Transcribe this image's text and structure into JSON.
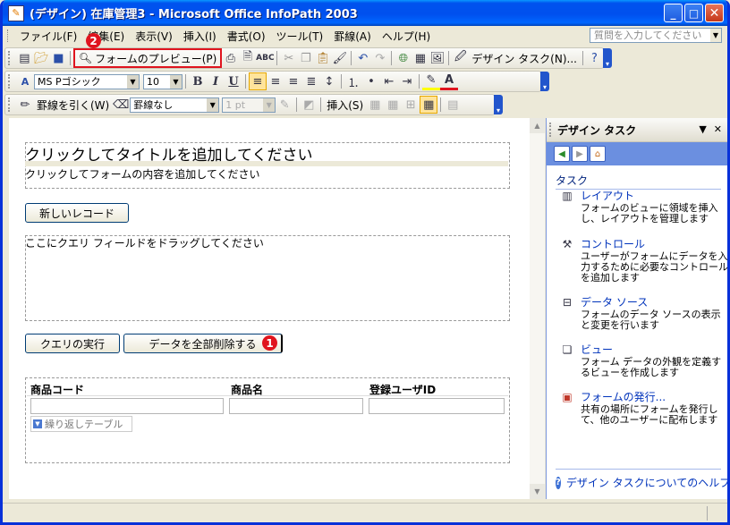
{
  "window": {
    "title": "(デザイン) 在庫管理3 - Microsoft Office InfoPath 2003",
    "app_icon": "infopath-icon",
    "minimize_glyph": "_",
    "maximize_glyph": "□",
    "close_glyph": "✕"
  },
  "menubar": {
    "items": [
      {
        "label": "ファイル(F)"
      },
      {
        "label": "編集(E)"
      },
      {
        "label": "表示(V)"
      },
      {
        "label": "挿入(I)"
      },
      {
        "label": "書式(O)"
      },
      {
        "label": "ツール(T)"
      },
      {
        "label": "罫線(A)"
      },
      {
        "label": "ヘルプ(H)"
      }
    ],
    "help_placeholder": "質問を入力してください"
  },
  "toolbar_standard": {
    "preview_label": "フォームのプレビュー(P)",
    "design_task_label": "デザイン タスク(N)...",
    "badge_preview": "2"
  },
  "toolbar_format": {
    "font_name": "MS Pゴシック",
    "font_size": "10",
    "bold": "B",
    "italic": "I",
    "underline": "U"
  },
  "toolbar_table": {
    "draw_table_label": "罫線を引く(W)",
    "border_style": "罫線なし",
    "border_width": "1 pt",
    "insert_label": "挿入(S)"
  },
  "form": {
    "title_placeholder": "クリックしてタイトルを追加してください",
    "content_placeholder": "クリックしてフォームの内容を追加してください",
    "new_record_button": "新しいレコード",
    "drag_placeholder": "ここにクエリ フィールドをドラッグしてください",
    "run_query_button": "クエリの実行",
    "delete_all_button": "データを全部削除する",
    "badge_delete": "1",
    "columns": [
      "商品コード",
      "商品名",
      "登録ユーザID"
    ],
    "repeating_table_label": "繰り返しテーブル"
  },
  "taskpane": {
    "title": "デザイン タスク",
    "section": "タスク",
    "items": [
      {
        "link": "レイアウト",
        "desc": "フォームのビューに領域を挿入し、レイアウトを管理します",
        "icon": "layout-icon"
      },
      {
        "link": "コントロール",
        "desc": "ユーザーがフォームにデータを入力するために必要なコントロールを追加します",
        "icon": "controls-icon"
      },
      {
        "link": "データ ソース",
        "desc": "フォームのデータ ソースの表示と変更を行います",
        "icon": "data-source-icon"
      },
      {
        "link": "ビュー",
        "desc": "フォーム データの外観を定義するビューを作成します",
        "icon": "views-icon"
      },
      {
        "link": "フォームの発行...",
        "desc": "共有の場所にフォームを発行して、他のユーザーに配布します",
        "icon": "publish-icon"
      }
    ],
    "footer_help": "デザイン タスクについてのヘルプ"
  },
  "colors": {
    "titlebar": "#0053ee",
    "highlight_red": "#e0141e",
    "link_blue": "#0033bb"
  }
}
